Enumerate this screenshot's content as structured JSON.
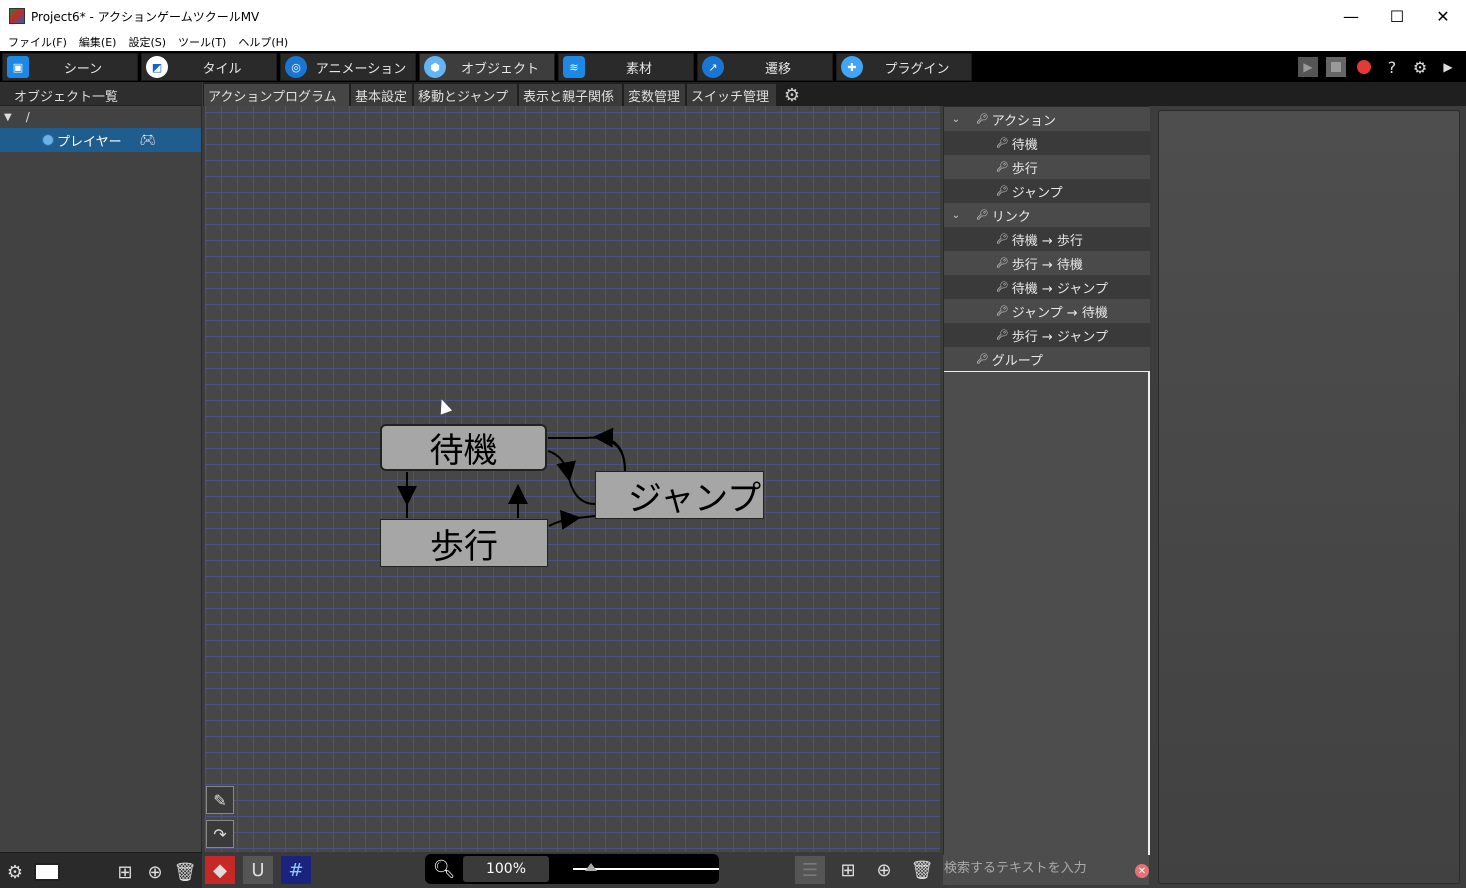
{
  "window": {
    "title": "Project6* - アクションゲームツクールMV",
    "controls": {
      "minimize": "—",
      "maximize": "☐",
      "close": "✕"
    }
  },
  "menu": [
    "ファイル(F)",
    "編集(E)",
    "設定(S)",
    "ツール(T)",
    "ヘルプ(H)"
  ],
  "main_tabs": [
    {
      "label": "シーン",
      "icon": "scene-icon"
    },
    {
      "label": "タイル",
      "icon": "tile-icon"
    },
    {
      "label": "アニメーション",
      "icon": "animation-icon"
    },
    {
      "label": "オブジェクト",
      "icon": "object-icon",
      "active": true
    },
    {
      "label": "素材",
      "icon": "material-icon"
    },
    {
      "label": "遷移",
      "icon": "transition-icon"
    },
    {
      "label": "プラグイン",
      "icon": "plugin-icon"
    }
  ],
  "left_panel": {
    "header": "オブジェクト一覧",
    "root": "/",
    "selected_item": "プレイヤー"
  },
  "sub_tabs": [
    "アクションプログラム",
    "基本設定",
    "移動とジャンプ",
    "表示と親子関係",
    "変数管理",
    "スイッチ管理"
  ],
  "canvas": {
    "nodes": {
      "wait": "待機",
      "walk": "歩行",
      "jump": "ジャンプ"
    }
  },
  "zoom": {
    "value": "100%",
    "level": 0.12
  },
  "tree": {
    "actions_header": "アクション",
    "actions": [
      "待機",
      "歩行",
      "ジャンプ"
    ],
    "links_header": "リンク",
    "links": [
      "待機 → 歩行",
      "歩行 → 待機",
      "待機 → ジャンプ",
      "ジャンプ → 待機",
      "歩行 → ジャンプ"
    ],
    "groups_header": "グループ"
  },
  "search": {
    "placeholder": "検索するテキストを入力"
  }
}
